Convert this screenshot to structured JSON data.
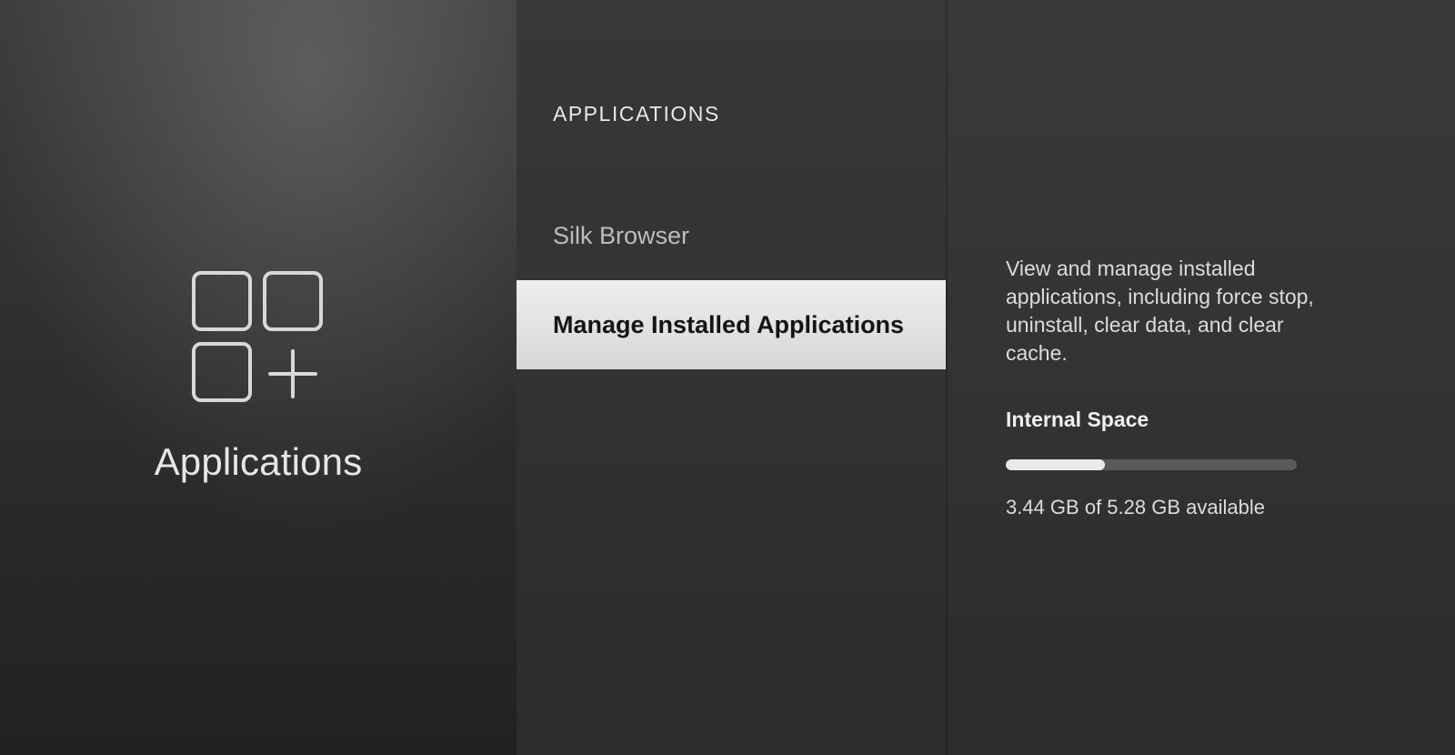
{
  "left": {
    "title": "Applications"
  },
  "mid": {
    "section_label": "APPLICATIONS",
    "items": [
      {
        "label": "Silk Browser",
        "selected": false
      },
      {
        "label": "Manage Installed Applications",
        "selected": true
      }
    ]
  },
  "right": {
    "description": "View and manage installed applications, including force stop, uninstall, clear data, and clear cache.",
    "storage_heading": "Internal Space",
    "storage_used_gb": 1.84,
    "storage_total_gb": 5.28,
    "storage_available_gb": 3.44,
    "storage_text": "3.44 GB of 5.28 GB available",
    "storage_fill_percent": 34
  }
}
